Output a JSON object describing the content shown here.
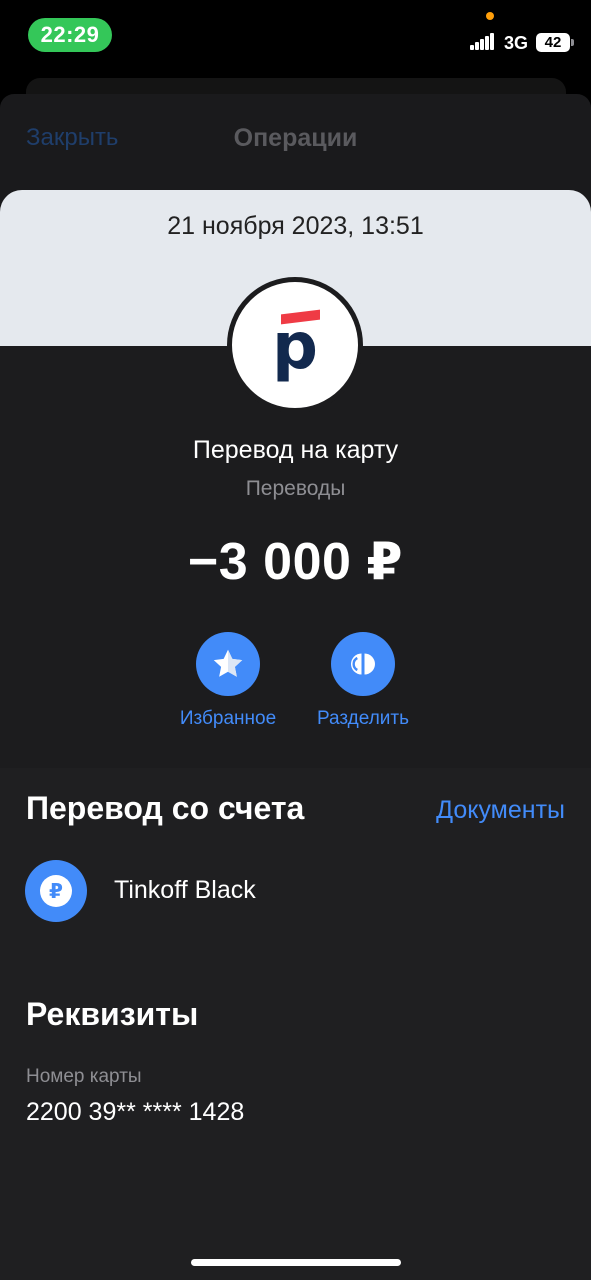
{
  "status_bar": {
    "time": "22:29",
    "network": "3G",
    "battery": "42",
    "time_pill_color": "#34c759"
  },
  "background_sheet": {
    "close_label": "Закрыть",
    "title": "Операции"
  },
  "operation": {
    "date": "21 ноября 2023, 13:51",
    "logo_letter": "р",
    "title": "Перевод на карту",
    "category": "Переводы",
    "amount": "−3 000 ₽"
  },
  "actions": [
    {
      "label": "Избранное",
      "icon": "star-icon"
    },
    {
      "label": "Разделить",
      "icon": "split-icon"
    }
  ],
  "transfer_section": {
    "title": "Перевод со счета",
    "documents_link": "Документы",
    "account_icon_glyph": "₽",
    "account_name": "Tinkoff Black"
  },
  "details_section": {
    "title": "Реквизиты",
    "card_label": "Номер карты",
    "card_number": "2200 39** **** 1428"
  },
  "colors": {
    "accent": "#428bf9",
    "sheet_background": "#1c1c1e",
    "header_background": "#e5e9ee",
    "logo_red": "#ef3b45",
    "logo_navy": "#12294e"
  }
}
